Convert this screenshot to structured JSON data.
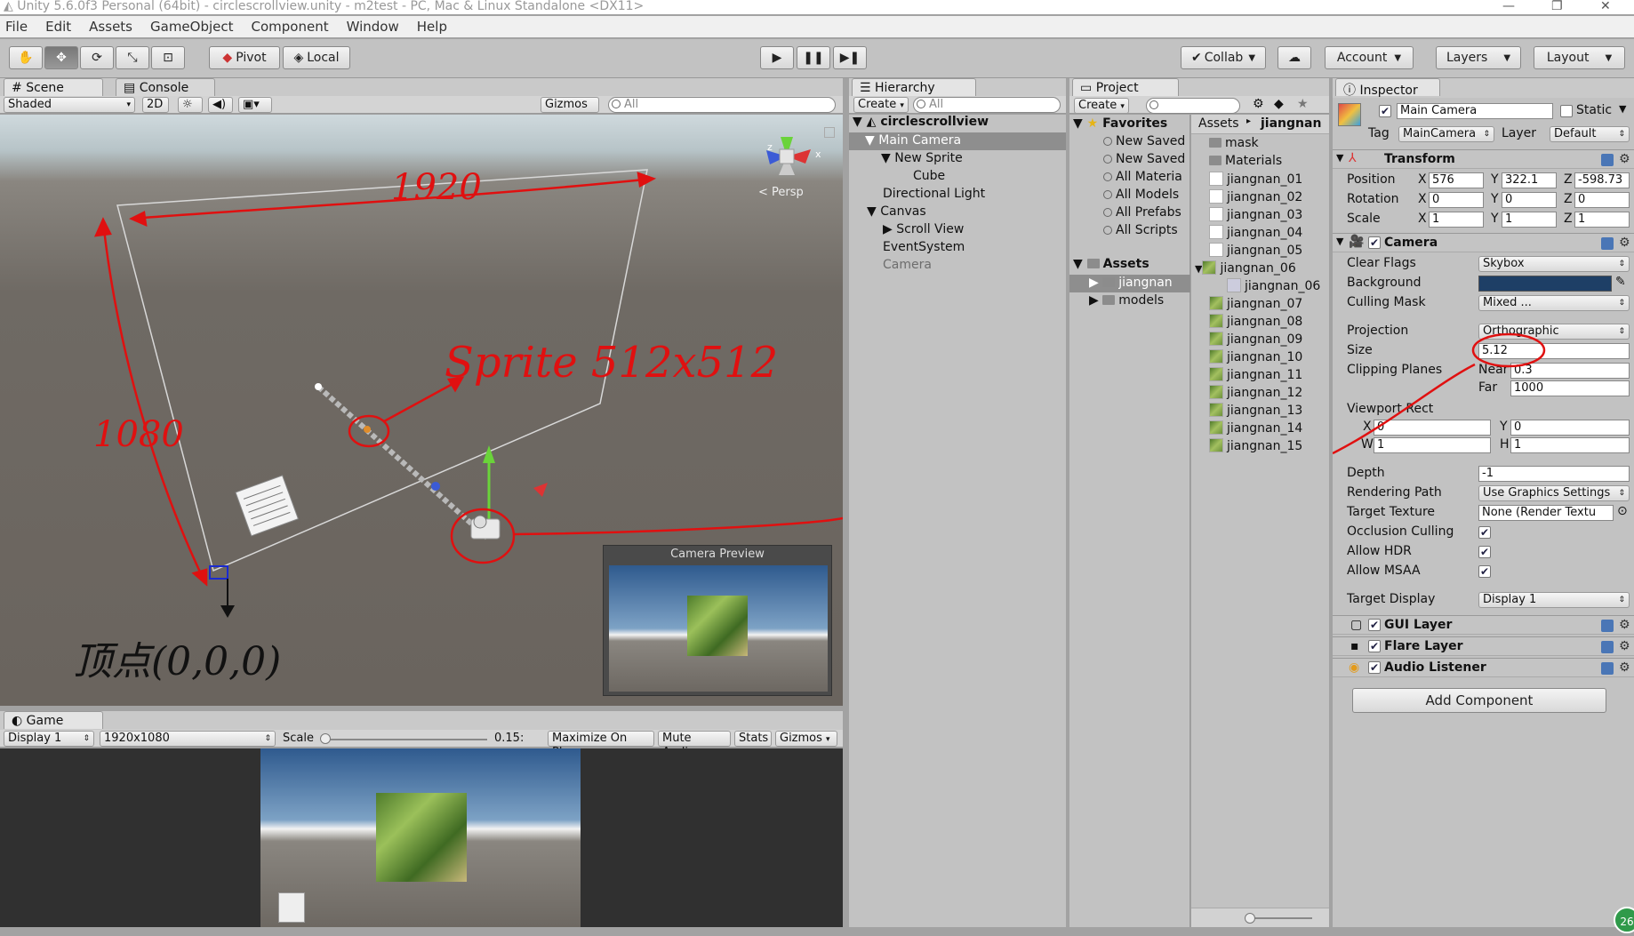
{
  "window": {
    "title": "Unity 5.6.0f3 Personal (64bit) - circlescrollview.unity - m2test - PC, Mac & Linux Standalone <DX11>",
    "controls": [
      "—",
      "❐",
      "✕"
    ]
  },
  "menu": [
    "File",
    "Edit",
    "Assets",
    "GameObject",
    "Component",
    "Window",
    "Help"
  ],
  "toolbar": {
    "pivot": "Pivot",
    "local": "Local",
    "collab": "Collab",
    "account": "Account",
    "layers": "Layers",
    "layout": "Layout"
  },
  "scene": {
    "tab_scene": "Scene",
    "tab_console": "Console",
    "shading": "Shaded",
    "mode_2d": "2D",
    "gizmos": "Gizmos",
    "search_placeholder": "All",
    "persp": "< Persp",
    "camera_preview": "Camera Preview",
    "annotations": {
      "width": "1920",
      "height": "1080",
      "sprite": "Sprite 512x512",
      "vertex": "顶点(0,0,0)"
    }
  },
  "game": {
    "tab": "Game",
    "display": "Display 1",
    "resolution": "1920x1080",
    "scale_label": "Scale",
    "scale_value": "0.15:",
    "maximize": "Maximize On Play",
    "mute": "Mute Audio",
    "stats": "Stats",
    "gizmos": "Gizmos"
  },
  "hierarchy": {
    "tab": "Hierarchy",
    "create": "Create",
    "search_placeholder": "All",
    "scene_name": "circlescrollview",
    "items": [
      {
        "label": "Main Camera",
        "depth": 1,
        "selected": true
      },
      {
        "label": "New Sprite",
        "depth": 1
      },
      {
        "label": "Cube",
        "depth": 2
      },
      {
        "label": "Directional Light",
        "depth": 1
      },
      {
        "label": "Canvas",
        "depth": 1
      },
      {
        "label": "Scroll View",
        "depth": 2
      },
      {
        "label": "EventSystem",
        "depth": 1
      },
      {
        "label": "Camera",
        "depth": 1,
        "disabled": true
      }
    ]
  },
  "project": {
    "tab": "Project",
    "create": "Create",
    "favorites": "Favorites",
    "favorite_items": [
      "New Saved",
      "New Saved",
      "All Materia",
      "All Models",
      "All Prefabs",
      "All Scripts"
    ],
    "assets": "Assets",
    "asset_folders": [
      "jiangnan",
      "models"
    ],
    "breadcrumb_root": "Assets",
    "breadcrumb_current": "jiangnan",
    "files": [
      {
        "name": "mask",
        "type": "folder"
      },
      {
        "name": "Materials",
        "type": "folder"
      },
      {
        "name": "jiangnan_01",
        "type": "white"
      },
      {
        "name": "jiangnan_02",
        "type": "white"
      },
      {
        "name": "jiangnan_03",
        "type": "white"
      },
      {
        "name": "jiangnan_04",
        "type": "white"
      },
      {
        "name": "jiangnan_05",
        "type": "white"
      },
      {
        "name": "jiangnan_06",
        "type": "green"
      },
      {
        "name": "jiangnan_06",
        "type": "sub"
      },
      {
        "name": "jiangnan_07",
        "type": "green"
      },
      {
        "name": "jiangnan_08",
        "type": "green"
      },
      {
        "name": "jiangnan_09",
        "type": "green"
      },
      {
        "name": "jiangnan_10",
        "type": "green"
      },
      {
        "name": "jiangnan_11",
        "type": "green"
      },
      {
        "name": "jiangnan_12",
        "type": "green"
      },
      {
        "name": "jiangnan_13",
        "type": "green"
      },
      {
        "name": "jiangnan_14",
        "type": "green"
      },
      {
        "name": "jiangnan_15",
        "type": "green"
      }
    ]
  },
  "inspector": {
    "tab": "Inspector",
    "object_name": "Main Camera",
    "static": "Static",
    "tag_label": "Tag",
    "tag": "MainCamera",
    "layer_label": "Layer",
    "layer": "Default",
    "transform": {
      "title": "Transform",
      "position_label": "Position",
      "rotation_label": "Rotation",
      "scale_label": "Scale",
      "position": {
        "x": "576",
        "y": "322.1",
        "z": "-598.73"
      },
      "rotation": {
        "x": "0",
        "y": "0",
        "z": "0"
      },
      "scale": {
        "x": "1",
        "y": "1",
        "z": "1"
      }
    },
    "camera": {
      "title": "Camera",
      "clear_flags_label": "Clear Flags",
      "clear_flags": "Skybox",
      "background_label": "Background",
      "background_color": "#1e3f66",
      "culling_mask_label": "Culling Mask",
      "culling_mask": "Mixed ...",
      "projection_label": "Projection",
      "projection": "Orthographic",
      "size_label": "Size",
      "size": "5.12",
      "clipping_label": "Clipping Planes",
      "near_label": "Near",
      "near": "0.3",
      "far_label": "Far",
      "far": "1000",
      "viewport_label": "Viewport Rect",
      "vx": "0",
      "vy": "0",
      "vw": "1",
      "vh": "1",
      "depth_label": "Depth",
      "depth": "-1",
      "rendering_path_label": "Rendering Path",
      "rendering_path": "Use Graphics Settings",
      "target_texture_label": "Target Texture",
      "target_texture": "None (Render Textu",
      "occlusion_label": "Occlusion Culling",
      "hdr_label": "Allow HDR",
      "msaa_label": "Allow MSAA",
      "target_display_label": "Target Display",
      "target_display": "Display 1"
    },
    "gui_layer": "GUI Layer",
    "flare_layer": "Flare Layer",
    "audio_listener": "Audio Listener",
    "add_component": "Add Component",
    "badge": "26"
  },
  "colors": {
    "annotation": "#e01010",
    "selection": "#8e8e8e",
    "panel": "#c2c2c2"
  }
}
